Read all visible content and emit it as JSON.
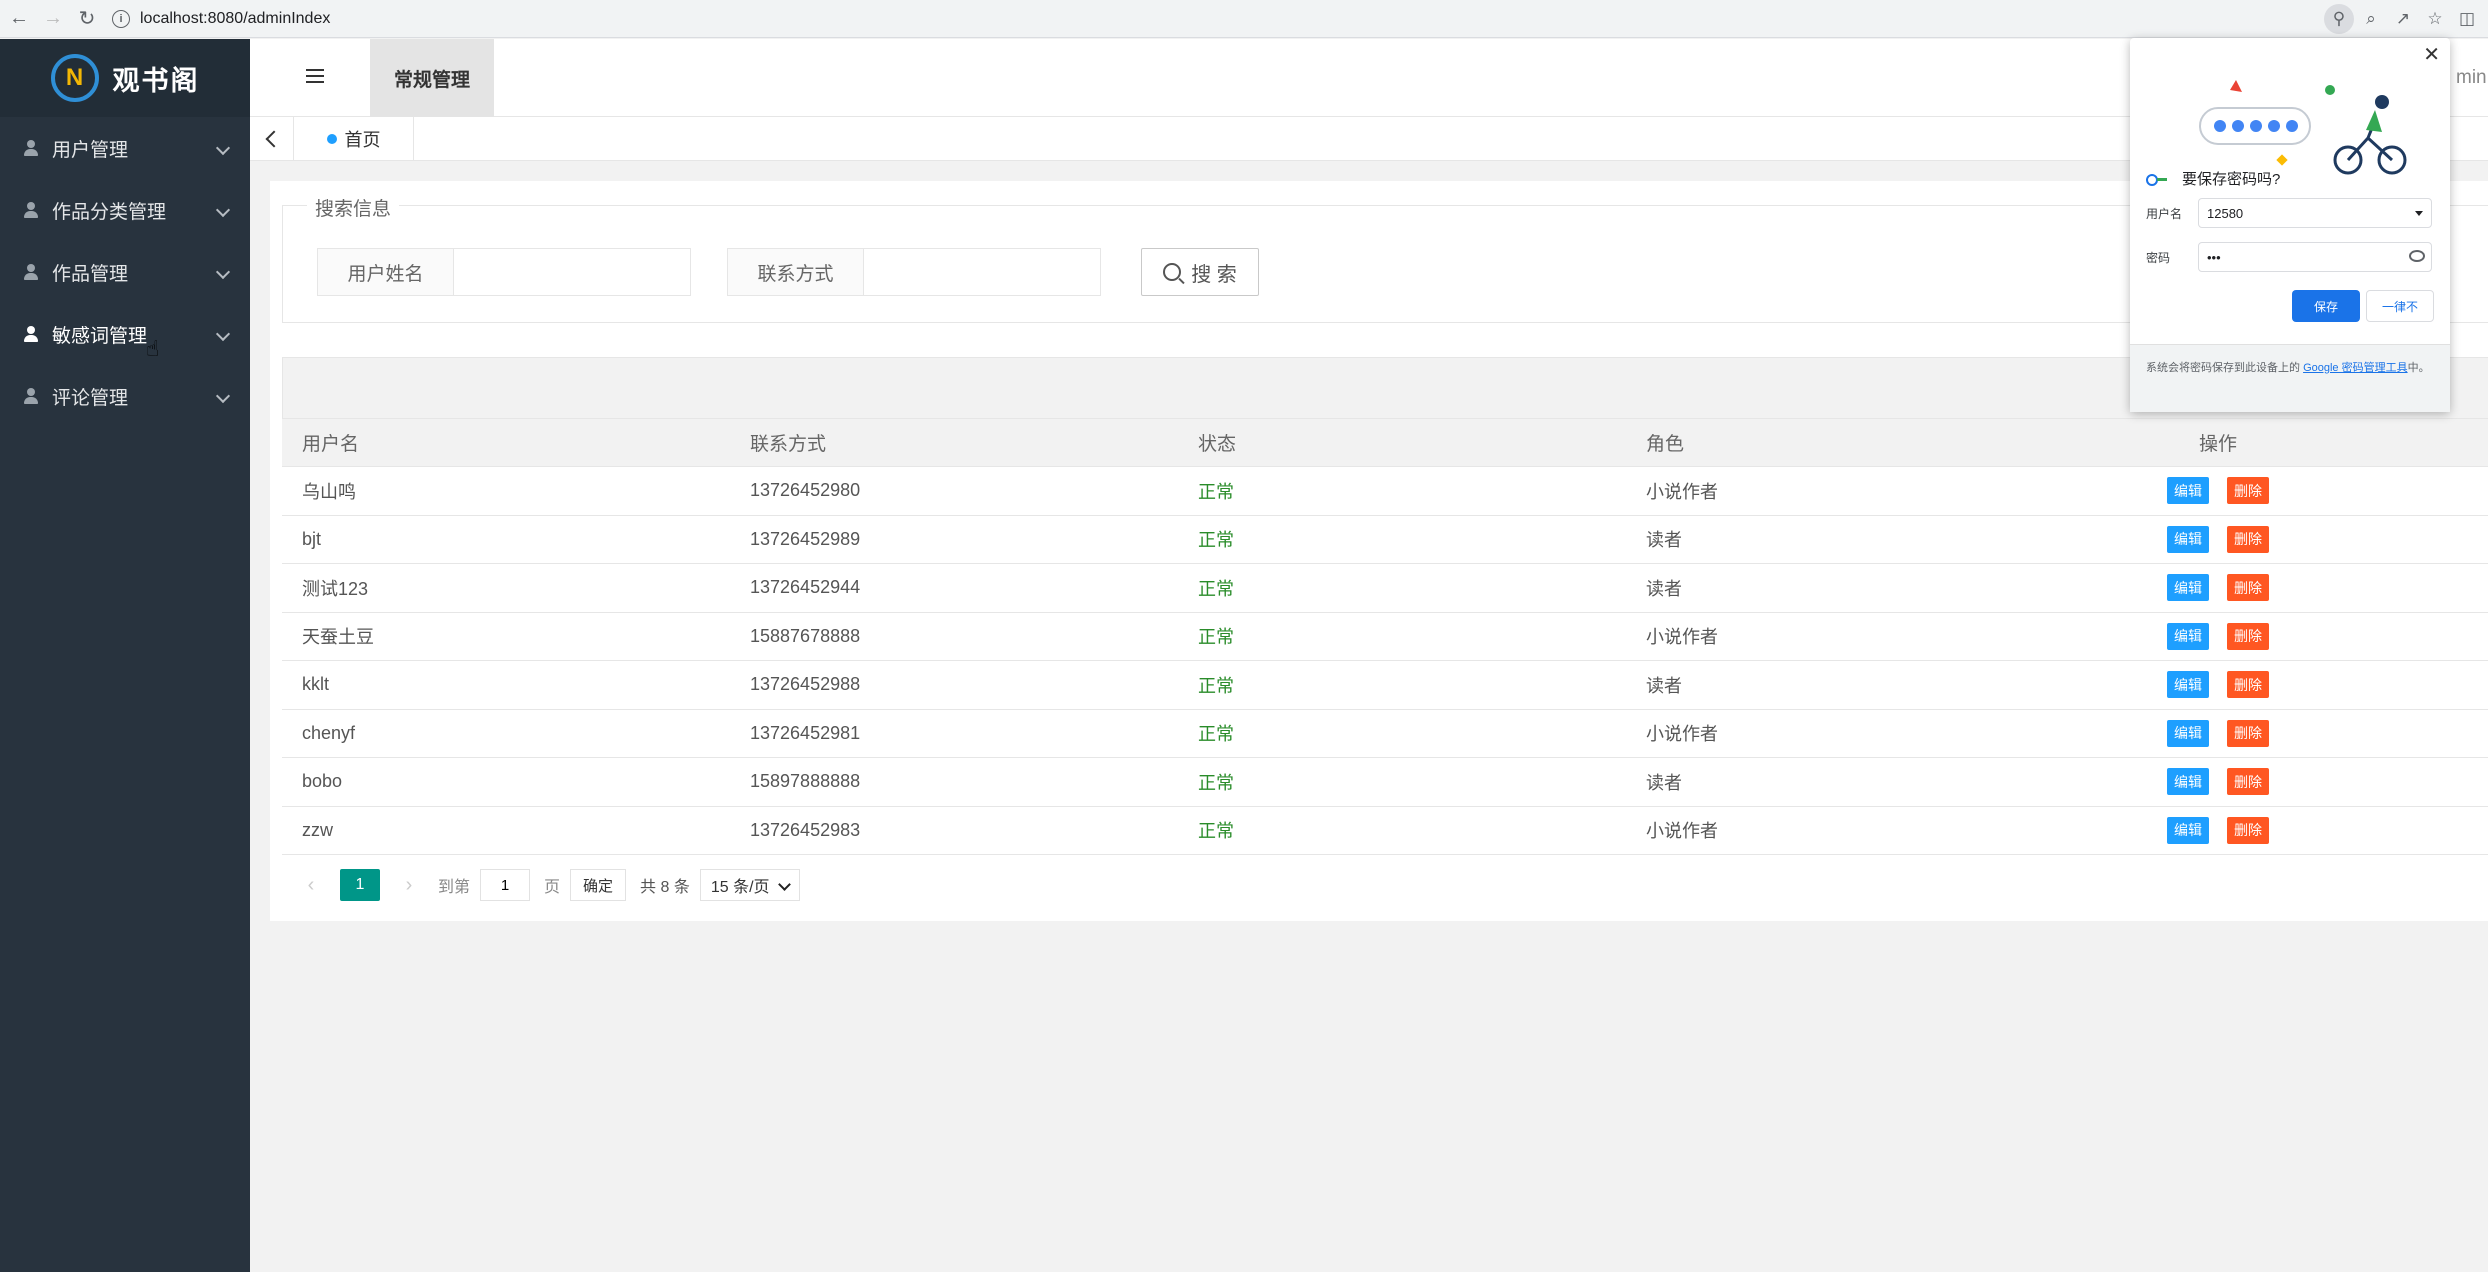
{
  "browser": {
    "url": "localhost:8080/adminIndex"
  },
  "sidebar": {
    "logo_mark": "N",
    "logo_text": "观书阁",
    "items": [
      {
        "label": "用户管理"
      },
      {
        "label": "作品分类管理"
      },
      {
        "label": "作品管理"
      },
      {
        "label": "敏感词管理"
      },
      {
        "label": "评论管理"
      }
    ]
  },
  "header": {
    "top_tab": "常规管理",
    "user_text": "min"
  },
  "tabs": {
    "home": "首页"
  },
  "search": {
    "legend": "搜索信息",
    "name_label": "用户姓名",
    "name_value": "",
    "contact_label": "联系方式",
    "contact_value": "",
    "button": "搜 索"
  },
  "table": {
    "headers": [
      "用户名",
      "联系方式",
      "状态",
      "角色",
      "操作"
    ],
    "edit_label": "编辑",
    "delete_label": "删除",
    "rows": [
      {
        "name": "乌山鸣",
        "contact": "13726452980",
        "status": "正常",
        "role": "小说作者"
      },
      {
        "name": "bjt",
        "contact": "13726452989",
        "status": "正常",
        "role": "读者"
      },
      {
        "name": "测试123",
        "contact": "13726452944",
        "status": "正常",
        "role": "读者"
      },
      {
        "name": "天蚕土豆",
        "contact": "15887678888",
        "status": "正常",
        "role": "小说作者"
      },
      {
        "name": "kklt",
        "contact": "13726452988",
        "status": "正常",
        "role": "读者"
      },
      {
        "name": "chenyf",
        "contact": "13726452981",
        "status": "正常",
        "role": "小说作者"
      },
      {
        "name": "bobo",
        "contact": "15897888888",
        "status": "正常",
        "role": "读者"
      },
      {
        "name": "zzw",
        "contact": "13726452983",
        "status": "正常",
        "role": "小说作者"
      }
    ]
  },
  "pager": {
    "current": "1",
    "goto_label": "到第",
    "goto_value": "1",
    "page_unit": "页",
    "confirm": "确定",
    "total": "共 8 条",
    "page_size": "15 条/页"
  },
  "password_popup": {
    "title": "要保存密码吗?",
    "username_label": "用户名",
    "username_value": "12580",
    "password_label": "密码",
    "password_value": "•••",
    "save": "保存",
    "never": "一律不",
    "footer_text": "系统会将密码保存到此设备上的 ",
    "footer_link": "Google 密码管理工具",
    "footer_end": "中。"
  },
  "colors": {
    "sidebar_bg": "#28333e",
    "primary": "#009688",
    "edit_btn": "#1e9fff",
    "delete_btn": "#ff5722",
    "status_ok": "#2a8c2a",
    "chrome_blue": "#1a73e8"
  }
}
